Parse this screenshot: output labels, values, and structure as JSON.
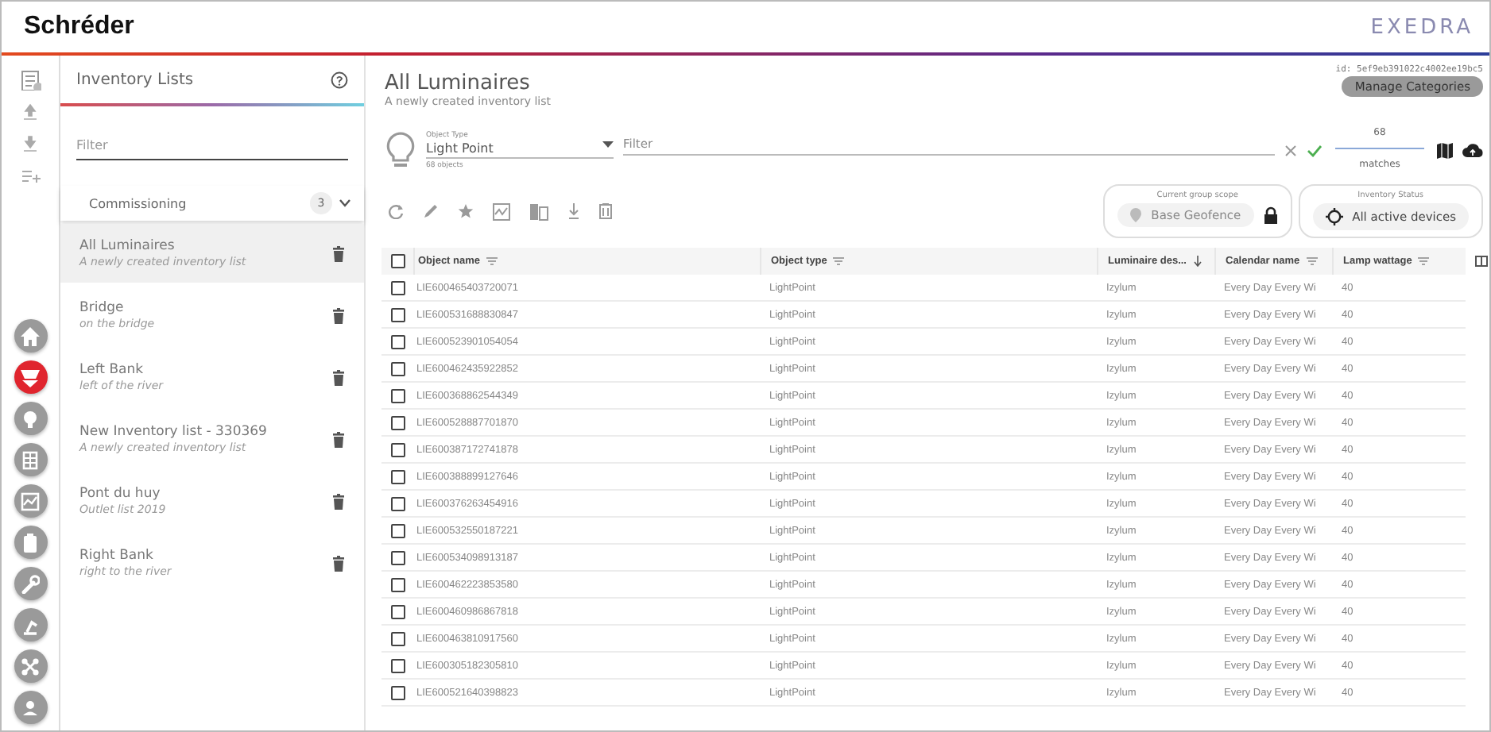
{
  "header": {
    "brand": "Schréder",
    "logo": "EXEDRA"
  },
  "rail": {
    "tools": [
      {
        "kind": "list"
      },
      {
        "kind": "upload"
      },
      {
        "kind": "download"
      },
      {
        "kind": "add"
      }
    ],
    "nav": [
      {
        "kind": "home",
        "selected": false
      },
      {
        "kind": "lamp",
        "selected": true
      },
      {
        "kind": "bulb",
        "selected": false
      },
      {
        "kind": "table",
        "selected": false
      },
      {
        "kind": "chart",
        "selected": false
      },
      {
        "kind": "battery",
        "selected": false
      },
      {
        "kind": "wrench",
        "selected": false
      },
      {
        "kind": "arm",
        "selected": false
      },
      {
        "kind": "drone",
        "selected": false
      },
      {
        "kind": "user",
        "selected": false
      }
    ]
  },
  "panel": {
    "title": "Inventory Lists",
    "filter": {
      "placeholder": "Filter"
    },
    "group": {
      "label": "Commissioning",
      "count": "3"
    },
    "lists": [
      {
        "name": "All Luminaires",
        "description": "A newly created inventory list",
        "selected": true
      },
      {
        "name": "Bridge",
        "description": "on the bridge",
        "selected": false
      },
      {
        "name": "Left Bank",
        "description": "left of the river",
        "selected": false
      },
      {
        "name": "New Inventory list - 330369",
        "description": "A newly created inventory list",
        "selected": false
      },
      {
        "name": "Pont du huy",
        "description": "Outlet list 2019",
        "selected": false
      },
      {
        "name": "Right Bank",
        "description": "right to the river",
        "selected": false
      }
    ]
  },
  "main": {
    "title": "All Luminaires",
    "subtitle": "A newly created inventory list",
    "id": "id: 5ef9eb391022c4002ee19bc5",
    "manage": "Manage Categories",
    "object_type": {
      "label": "Object Type",
      "value": "Light Point",
      "count": "68 objects"
    },
    "filter": {
      "placeholder": "Filter"
    },
    "matches": {
      "count": "68",
      "label": "matches"
    },
    "scope": {
      "label": "Current group scope",
      "value": "Base Geofence"
    },
    "status": {
      "label": "Inventory Status",
      "value": "All active devices"
    },
    "table": {
      "all_checked": false,
      "columns": [
        {
          "label": "Object name",
          "sorted": false
        },
        {
          "label": "Object type",
          "sorted": false
        },
        {
          "label": "Luminaire des...",
          "sorted": true
        },
        {
          "label": "Calendar name",
          "sorted": false
        },
        {
          "label": "Lamp wattage",
          "sorted": false
        }
      ],
      "rows": [
        {
          "checked": false,
          "cells": [
            "LIE600465403720071",
            "LightPoint",
            "Izylum",
            "Every Day Every Wi",
            "40"
          ]
        },
        {
          "checked": false,
          "cells": [
            "LIE600531688830847",
            "LightPoint",
            "Izylum",
            "Every Day Every Wi",
            "40"
          ]
        },
        {
          "checked": false,
          "cells": [
            "LIE600523901054054",
            "LightPoint",
            "Izylum",
            "Every Day Every Wi",
            "40"
          ]
        },
        {
          "checked": false,
          "cells": [
            "LIE600462435922852",
            "LightPoint",
            "Izylum",
            "Every Day Every Wi",
            "40"
          ]
        },
        {
          "checked": false,
          "cells": [
            "LIE600368862544349",
            "LightPoint",
            "Izylum",
            "Every Day Every Wi",
            "40"
          ]
        },
        {
          "checked": false,
          "cells": [
            "LIE600528887701870",
            "LightPoint",
            "Izylum",
            "Every Day Every Wi",
            "40"
          ]
        },
        {
          "checked": false,
          "cells": [
            "LIE600387172741878",
            "LightPoint",
            "Izylum",
            "Every Day Every Wi",
            "40"
          ]
        },
        {
          "checked": false,
          "cells": [
            "LIE600388899127646",
            "LightPoint",
            "Izylum",
            "Every Day Every Wi",
            "40"
          ]
        },
        {
          "checked": false,
          "cells": [
            "LIE600376263454916",
            "LightPoint",
            "Izylum",
            "Every Day Every Wi",
            "40"
          ]
        },
        {
          "checked": false,
          "cells": [
            "LIE600532550187221",
            "LightPoint",
            "Izylum",
            "Every Day Every Wi",
            "40"
          ]
        },
        {
          "checked": false,
          "cells": [
            "LIE600534098913187",
            "LightPoint",
            "Izylum",
            "Every Day Every Wi",
            "40"
          ]
        },
        {
          "checked": false,
          "cells": [
            "LIE600462223853580",
            "LightPoint",
            "Izylum",
            "Every Day Every Wi",
            "40"
          ]
        },
        {
          "checked": false,
          "cells": [
            "LIE600460986867818",
            "LightPoint",
            "Izylum",
            "Every Day Every Wi",
            "40"
          ]
        },
        {
          "checked": false,
          "cells": [
            "LIE600463810917560",
            "LightPoint",
            "Izylum",
            "Every Day Every Wi",
            "40"
          ]
        },
        {
          "checked": false,
          "cells": [
            "LIE600305182305810",
            "LightPoint",
            "Izylum",
            "Every Day Every Wi",
            "40"
          ]
        },
        {
          "checked": false,
          "cells": [
            "LIE600521640398823",
            "LightPoint",
            "Izylum",
            "Every Day Every Wi",
            "40"
          ]
        }
      ]
    }
  }
}
